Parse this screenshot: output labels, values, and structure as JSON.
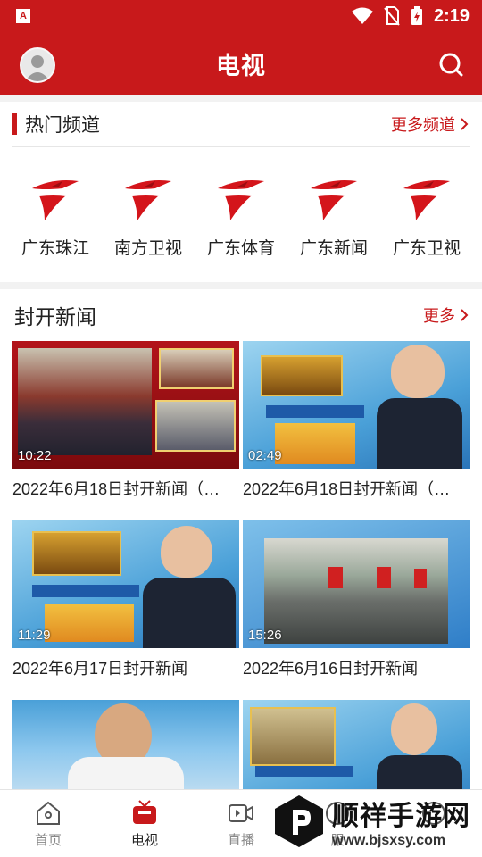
{
  "status": {
    "time": "2:19"
  },
  "header": {
    "title": "电视"
  },
  "channels": {
    "title": "热门频道",
    "more": "更多频道",
    "items": [
      {
        "name": "广东珠江"
      },
      {
        "name": "南方卫视"
      },
      {
        "name": "广东体育"
      },
      {
        "name": "广东新闻"
      },
      {
        "name": "广东卫视"
      }
    ]
  },
  "news": {
    "title": "封开新闻",
    "more": "更多",
    "items": [
      {
        "title": "2022年6月18日封开新闻（…",
        "duration": "10:22"
      },
      {
        "title": "2022年6月18日封开新闻（…",
        "duration": "02:49"
      },
      {
        "title": "2022年6月17日封开新闻",
        "duration": "11:29"
      },
      {
        "title": "2022年6月16日封开新闻",
        "duration": "15:26"
      },
      {
        "title": "",
        "duration": ""
      },
      {
        "title": "",
        "duration": ""
      }
    ]
  },
  "tabs": [
    {
      "label": "首页",
      "icon": "home-icon"
    },
    {
      "label": "电视",
      "icon": "tv-icon",
      "active": true
    },
    {
      "label": "直播",
      "icon": "video-icon"
    },
    {
      "label": "服",
      "icon": "service-icon"
    },
    {
      "label": "",
      "icon": "user-icon"
    }
  ],
  "watermark": {
    "brand": "顺祥手游网",
    "url": "www.bjsxsy.com"
  },
  "colors": {
    "brand": "#c8191b",
    "text": "#222222"
  }
}
